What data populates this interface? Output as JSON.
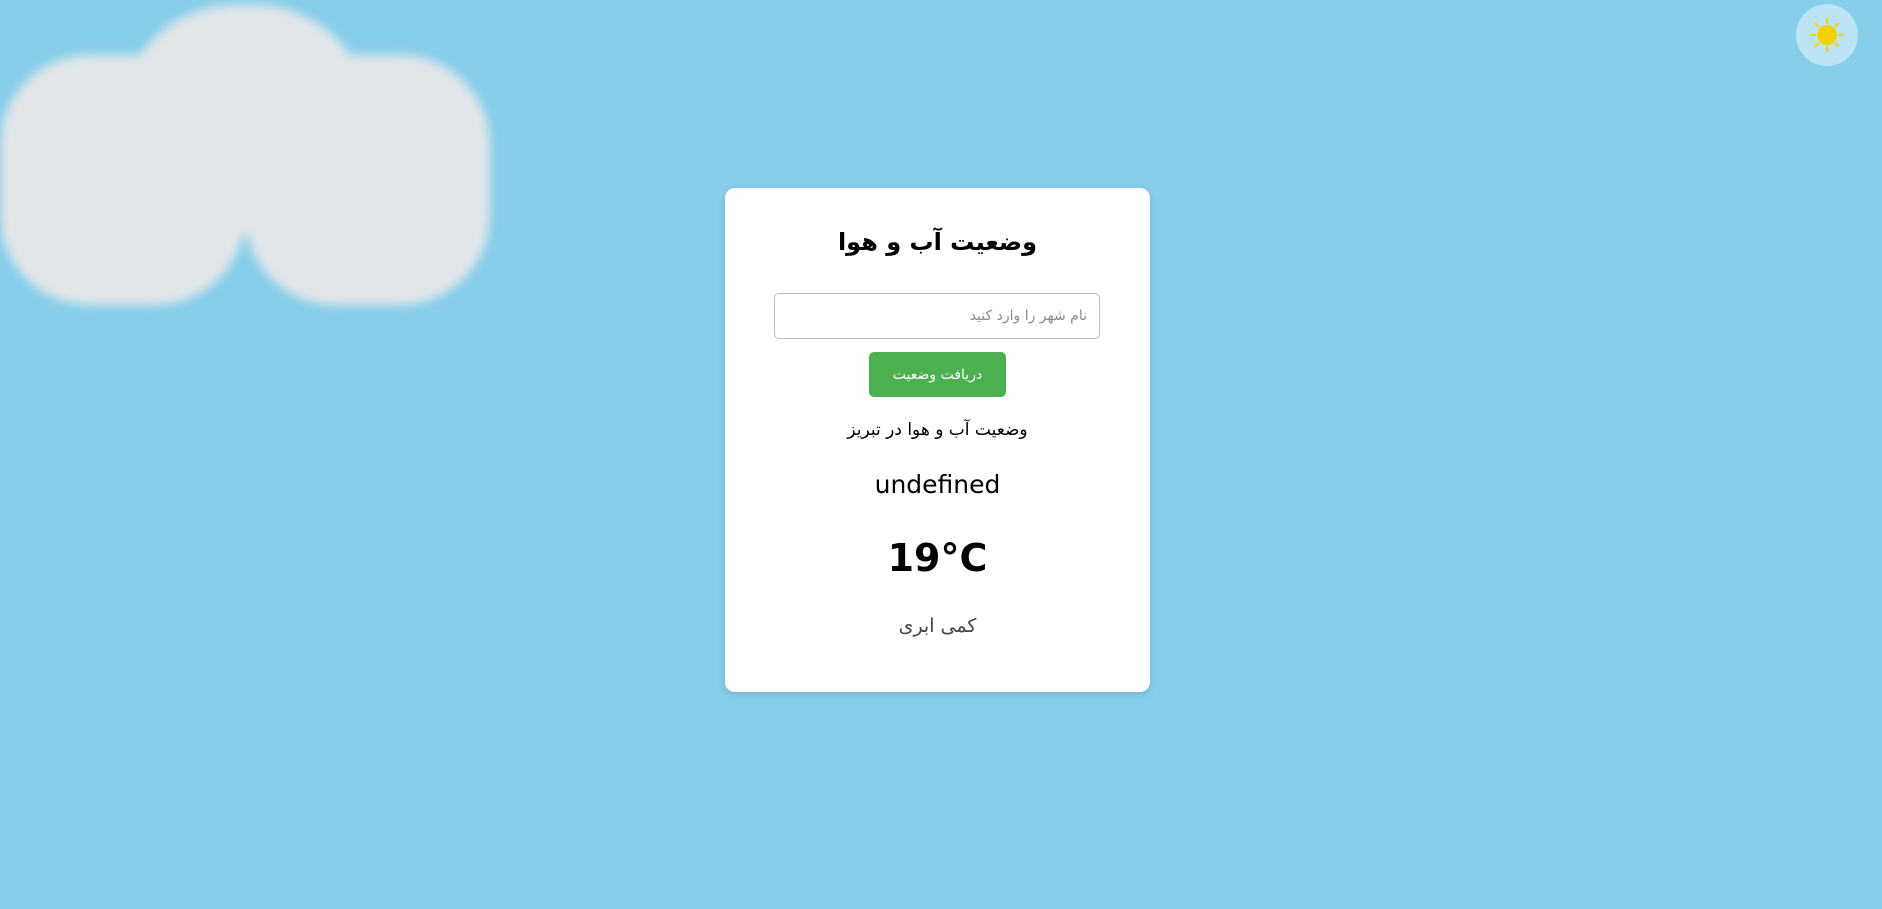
{
  "app": {
    "title": "وضعیت آب و هوا"
  },
  "search": {
    "placeholder": "نام شهر را وارد کنید",
    "value": "",
    "button_label": "دریافت وضعیت"
  },
  "result": {
    "city_line": "وضعیت آب و هوا در تبریز",
    "icon_text": "undefined",
    "temperature": "19°C",
    "description": "کمی ابری"
  },
  "icons": {
    "theme_toggle": "sun-icon",
    "background": "cloud-shape"
  },
  "colors": {
    "background": "#87ceeb",
    "button": "#4caf50",
    "sun": "#f5d000",
    "card": "#ffffff"
  }
}
